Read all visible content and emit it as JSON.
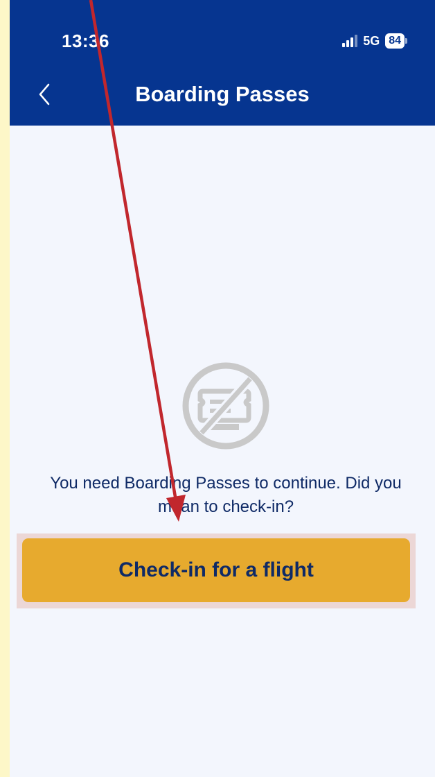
{
  "status_bar": {
    "time": "13:36",
    "network": "5G",
    "battery": "84"
  },
  "header": {
    "title": "Boarding Passes",
    "back_icon": "chevron-left-icon"
  },
  "empty_state": {
    "icon": "no-boarding-pass-icon",
    "message": "You need Boarding Passes to continue. Did you mean to check-in?"
  },
  "cta": {
    "label": "Check-in for a flight"
  },
  "colors": {
    "header": "#063590",
    "background": "#f3f6fd",
    "button": "#e7aa2e",
    "text": "#0f2a66",
    "annotation_arrow": "#c1272d",
    "outer_background": "#fdf7c8"
  }
}
